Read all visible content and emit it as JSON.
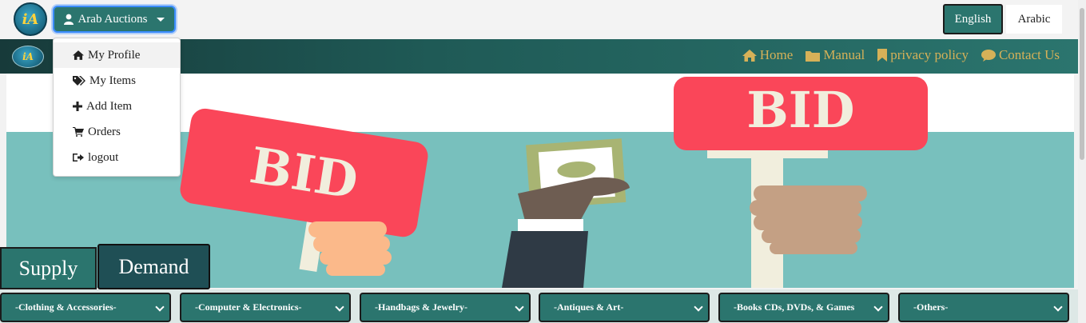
{
  "header": {
    "user_menu_label": "Arab Auctions",
    "languages": [
      "English",
      "Arabic"
    ]
  },
  "user_menu": {
    "items": [
      {
        "label": "My Profile",
        "icon": "home-icon"
      },
      {
        "label": "My Items",
        "icon": "tags-icon"
      },
      {
        "label": "Add Item",
        "icon": "plus-icon"
      },
      {
        "label": "Orders",
        "icon": "cart-icon"
      },
      {
        "label": "logout",
        "icon": "sign-out-icon"
      }
    ]
  },
  "nav": {
    "links": [
      {
        "label": "Home",
        "icon": "home-icon"
      },
      {
        "label": "Manual",
        "icon": "folder-icon"
      },
      {
        "label": "privacy policy",
        "icon": "bookmark-icon"
      },
      {
        "label": "Contact Us",
        "icon": "comment-icon"
      }
    ]
  },
  "banner": {
    "sign_left": "BID",
    "sign_right": "BID"
  },
  "tabs": {
    "supply": "Supply",
    "demand": "Demand"
  },
  "categories": [
    "-Clothing & Accessories-",
    "-Computer & Electronics-",
    "-Handbags & Jewelry-",
    "-Antiques & Art-",
    "-Books CDs, DVDs, & Games",
    "-Others-"
  ],
  "colors": {
    "primary": "#2b756e",
    "nav_gold": "#d6b158",
    "banner_teal": "#78c0bd",
    "sign_red": "#fa4659"
  }
}
